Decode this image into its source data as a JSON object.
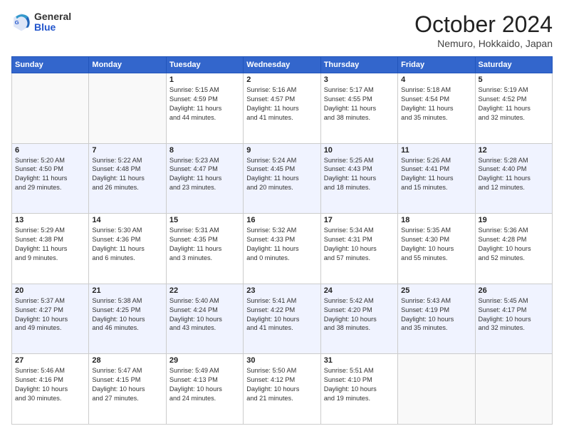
{
  "logo": {
    "general": "General",
    "blue": "Blue"
  },
  "header": {
    "title": "October 2024",
    "location": "Nemuro, Hokkaido, Japan"
  },
  "days_of_week": [
    "Sunday",
    "Monday",
    "Tuesday",
    "Wednesday",
    "Thursday",
    "Friday",
    "Saturday"
  ],
  "weeks": [
    [
      {
        "day": "",
        "info": ""
      },
      {
        "day": "",
        "info": ""
      },
      {
        "day": "1",
        "info": "Sunrise: 5:15 AM\nSunset: 4:59 PM\nDaylight: 11 hours\nand 44 minutes."
      },
      {
        "day": "2",
        "info": "Sunrise: 5:16 AM\nSunset: 4:57 PM\nDaylight: 11 hours\nand 41 minutes."
      },
      {
        "day": "3",
        "info": "Sunrise: 5:17 AM\nSunset: 4:55 PM\nDaylight: 11 hours\nand 38 minutes."
      },
      {
        "day": "4",
        "info": "Sunrise: 5:18 AM\nSunset: 4:54 PM\nDaylight: 11 hours\nand 35 minutes."
      },
      {
        "day": "5",
        "info": "Sunrise: 5:19 AM\nSunset: 4:52 PM\nDaylight: 11 hours\nand 32 minutes."
      }
    ],
    [
      {
        "day": "6",
        "info": "Sunrise: 5:20 AM\nSunset: 4:50 PM\nDaylight: 11 hours\nand 29 minutes."
      },
      {
        "day": "7",
        "info": "Sunrise: 5:22 AM\nSunset: 4:48 PM\nDaylight: 11 hours\nand 26 minutes."
      },
      {
        "day": "8",
        "info": "Sunrise: 5:23 AM\nSunset: 4:47 PM\nDaylight: 11 hours\nand 23 minutes."
      },
      {
        "day": "9",
        "info": "Sunrise: 5:24 AM\nSunset: 4:45 PM\nDaylight: 11 hours\nand 20 minutes."
      },
      {
        "day": "10",
        "info": "Sunrise: 5:25 AM\nSunset: 4:43 PM\nDaylight: 11 hours\nand 18 minutes."
      },
      {
        "day": "11",
        "info": "Sunrise: 5:26 AM\nSunset: 4:41 PM\nDaylight: 11 hours\nand 15 minutes."
      },
      {
        "day": "12",
        "info": "Sunrise: 5:28 AM\nSunset: 4:40 PM\nDaylight: 11 hours\nand 12 minutes."
      }
    ],
    [
      {
        "day": "13",
        "info": "Sunrise: 5:29 AM\nSunset: 4:38 PM\nDaylight: 11 hours\nand 9 minutes."
      },
      {
        "day": "14",
        "info": "Sunrise: 5:30 AM\nSunset: 4:36 PM\nDaylight: 11 hours\nand 6 minutes."
      },
      {
        "day": "15",
        "info": "Sunrise: 5:31 AM\nSunset: 4:35 PM\nDaylight: 11 hours\nand 3 minutes."
      },
      {
        "day": "16",
        "info": "Sunrise: 5:32 AM\nSunset: 4:33 PM\nDaylight: 11 hours\nand 0 minutes."
      },
      {
        "day": "17",
        "info": "Sunrise: 5:34 AM\nSunset: 4:31 PM\nDaylight: 10 hours\nand 57 minutes."
      },
      {
        "day": "18",
        "info": "Sunrise: 5:35 AM\nSunset: 4:30 PM\nDaylight: 10 hours\nand 55 minutes."
      },
      {
        "day": "19",
        "info": "Sunrise: 5:36 AM\nSunset: 4:28 PM\nDaylight: 10 hours\nand 52 minutes."
      }
    ],
    [
      {
        "day": "20",
        "info": "Sunrise: 5:37 AM\nSunset: 4:27 PM\nDaylight: 10 hours\nand 49 minutes."
      },
      {
        "day": "21",
        "info": "Sunrise: 5:38 AM\nSunset: 4:25 PM\nDaylight: 10 hours\nand 46 minutes."
      },
      {
        "day": "22",
        "info": "Sunrise: 5:40 AM\nSunset: 4:24 PM\nDaylight: 10 hours\nand 43 minutes."
      },
      {
        "day": "23",
        "info": "Sunrise: 5:41 AM\nSunset: 4:22 PM\nDaylight: 10 hours\nand 41 minutes."
      },
      {
        "day": "24",
        "info": "Sunrise: 5:42 AM\nSunset: 4:20 PM\nDaylight: 10 hours\nand 38 minutes."
      },
      {
        "day": "25",
        "info": "Sunrise: 5:43 AM\nSunset: 4:19 PM\nDaylight: 10 hours\nand 35 minutes."
      },
      {
        "day": "26",
        "info": "Sunrise: 5:45 AM\nSunset: 4:17 PM\nDaylight: 10 hours\nand 32 minutes."
      }
    ],
    [
      {
        "day": "27",
        "info": "Sunrise: 5:46 AM\nSunset: 4:16 PM\nDaylight: 10 hours\nand 30 minutes."
      },
      {
        "day": "28",
        "info": "Sunrise: 5:47 AM\nSunset: 4:15 PM\nDaylight: 10 hours\nand 27 minutes."
      },
      {
        "day": "29",
        "info": "Sunrise: 5:49 AM\nSunset: 4:13 PM\nDaylight: 10 hours\nand 24 minutes."
      },
      {
        "day": "30",
        "info": "Sunrise: 5:50 AM\nSunset: 4:12 PM\nDaylight: 10 hours\nand 21 minutes."
      },
      {
        "day": "31",
        "info": "Sunrise: 5:51 AM\nSunset: 4:10 PM\nDaylight: 10 hours\nand 19 minutes."
      },
      {
        "day": "",
        "info": ""
      },
      {
        "day": "",
        "info": ""
      }
    ]
  ]
}
